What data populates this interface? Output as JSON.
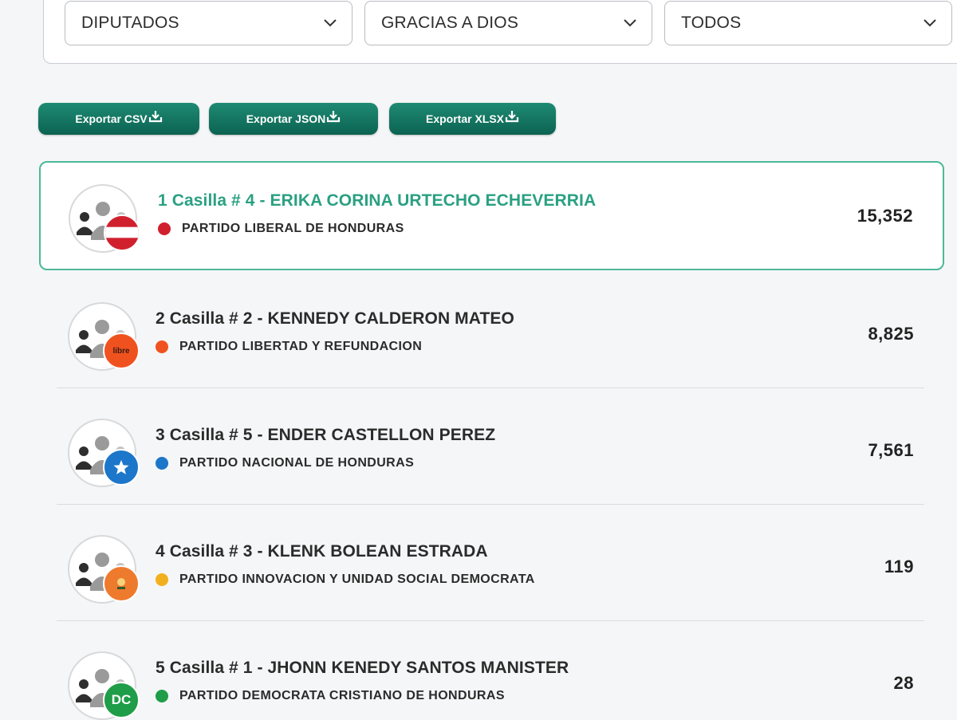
{
  "filters": [
    {
      "value": "DIPUTADOS"
    },
    {
      "value": "GRACIAS A DIOS"
    },
    {
      "value": "TODOS"
    }
  ],
  "export_buttons": [
    {
      "label": "Exportar CSV"
    },
    {
      "label": "Exportar JSON"
    },
    {
      "label": "Exportar XLSX"
    }
  ],
  "candidates": [
    {
      "name": "1 Casilla # 4 - ERIKA CORINA URTECHO ECHEVERRIA",
      "party": "PARTIDO LIBERAL DE HONDURAS",
      "votes": "15,352",
      "party_color": "#d0202e"
    },
    {
      "name": "2 Casilla # 2 - KENNEDY CALDERON MATEO",
      "party": "PARTIDO LIBERTAD Y REFUNDACION",
      "votes": "8,825",
      "party_color": "#f0521f",
      "badge_text": "libre"
    },
    {
      "name": "3 Casilla # 5 - ENDER CASTELLON PEREZ",
      "party": "PARTIDO NACIONAL DE HONDURAS",
      "votes": "7,561",
      "party_color": "#1c76c9"
    },
    {
      "name": "4 Casilla # 3 - KLENK BOLEAN ESTRADA",
      "party": "PARTIDO INNOVACION Y UNIDAD SOCIAL DEMOCRATA",
      "votes": "119",
      "party_color": "#f2b01e"
    },
    {
      "name": "5 Casilla # 1 - JHONN KENEDY SANTOS MANISTER",
      "party": "PARTIDO DEMOCRATA CRISTIANO DE HONDURAS",
      "votes": "28",
      "party_color": "#1f9d48",
      "badge_text": "DC"
    }
  ]
}
